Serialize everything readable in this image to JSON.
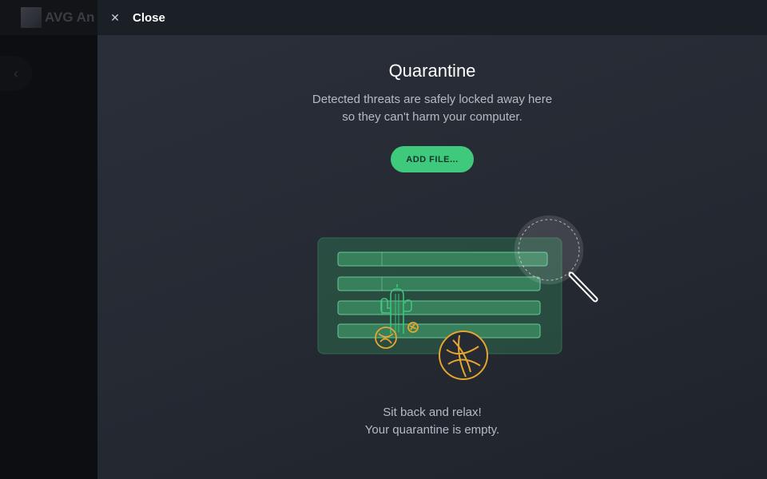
{
  "background_app": {
    "name": "AVG An"
  },
  "topbar": {
    "close_label": "Close"
  },
  "page": {
    "title": "Quarantine",
    "description_line1": "Detected threats are safely locked away here",
    "description_line2": "so they can't harm your computer.",
    "add_file_label": "ADD FILE...",
    "empty_line1": "Sit back and relax!",
    "empty_line2": "Your quarantine is empty."
  },
  "colors": {
    "accent": "#3ec97c",
    "panel_bg": "#262a33",
    "illustration_green": "#2f8a5e",
    "tumbleweed": "#e6a52e"
  },
  "icons": {
    "close": "close-icon",
    "back": "chevron-left-icon",
    "magnifier": "magnifier-icon",
    "cactus": "cactus-icon",
    "tumbleweed": "tumbleweed-icon"
  }
}
